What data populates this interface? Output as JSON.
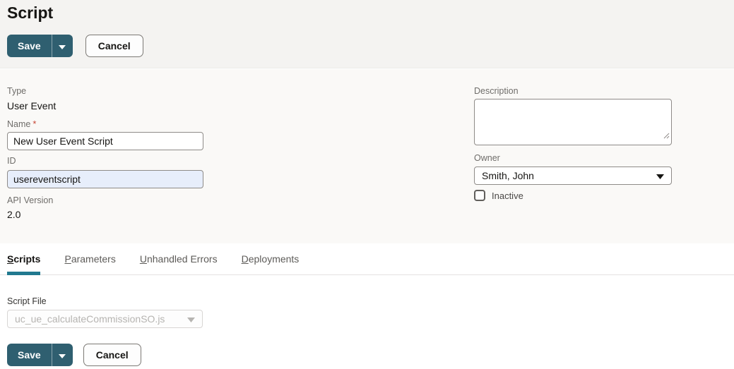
{
  "page": {
    "title": "Script"
  },
  "toolbar": {
    "save_label": "Save",
    "cancel_label": "Cancel"
  },
  "form": {
    "type": {
      "label": "Type",
      "value": "User Event"
    },
    "name": {
      "label": "Name",
      "required_marker": "*",
      "value": "New User Event Script"
    },
    "id": {
      "label": "ID",
      "value": "usereventscript"
    },
    "api_version": {
      "label": "API Version",
      "value": "2.0"
    },
    "description": {
      "label": "Description",
      "value": ""
    },
    "owner": {
      "label": "Owner",
      "value": "Smith, John"
    },
    "inactive": {
      "label": "Inactive",
      "checked": false
    }
  },
  "tabs": [
    {
      "label": "Scripts",
      "active": true
    },
    {
      "label": "Parameters",
      "active": false
    },
    {
      "label": "Unhandled Errors",
      "active": false
    },
    {
      "label": "Deployments",
      "active": false
    }
  ],
  "script_file": {
    "label": "Script File",
    "value": "uc_ue_calculateCommissionSO.js",
    "disabled": true
  },
  "colors": {
    "primary_button": "#2f5f70",
    "active_tab_underline": "#21798f",
    "header_background": "#f4f3f1",
    "form_background": "#faf9f7",
    "autofill_field_background": "#e7eefb",
    "required_asterisk": "#c74634"
  }
}
